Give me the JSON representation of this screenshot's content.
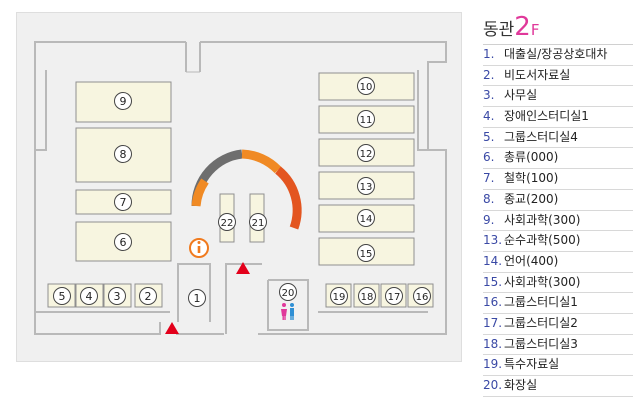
{
  "legend": {
    "building": "동관",
    "floor": "2",
    "floor_suffix": "F",
    "items": [
      {
        "num": "1.",
        "label": "대출실/장공상호대차"
      },
      {
        "num": "2.",
        "label": "비도서자료실"
      },
      {
        "num": "3.",
        "label": "사무실"
      },
      {
        "num": "4.",
        "label": "장애인스터디실1"
      },
      {
        "num": "5.",
        "label": "그룹스터디실4"
      },
      {
        "num": "6.",
        "label": "총류(000)"
      },
      {
        "num": "7.",
        "label": "철학(100)"
      },
      {
        "num": "8.",
        "label": "종교(200)"
      },
      {
        "num": "9.",
        "label": "사회과학(300)"
      },
      {
        "num": "13.",
        "label": "순수과학(500)"
      },
      {
        "num": "14.",
        "label": "언어(400)"
      },
      {
        "num": "15.",
        "label": "사회과학(300)"
      },
      {
        "num": "16.",
        "label": "그룹스터디실1"
      },
      {
        "num": "17.",
        "label": "그룹스터디실2"
      },
      {
        "num": "18.",
        "label": "그룹스터디실3"
      },
      {
        "num": "19.",
        "label": "특수자료실"
      },
      {
        "num": "20.",
        "label": "화장실"
      }
    ]
  },
  "map": {
    "rooms": [
      "9",
      "8",
      "7",
      "6",
      "10",
      "11",
      "12",
      "13",
      "14",
      "15",
      "5",
      "4",
      "3",
      "2",
      "1",
      "20",
      "19",
      "18",
      "17",
      "16",
      "22",
      "21"
    ],
    "info_icon": "info-icon",
    "entrance_icon": "entrance-triangle-icon",
    "restroom_icon": "restroom-icon"
  },
  "colors": {
    "room_fill": "#f7f5e0",
    "arc_gray": "#6e6e6e",
    "arc_orange": "#f08a24",
    "arc_red": "#e35520",
    "entrance_red": "#e3001b",
    "info_orange": "#f07a1e",
    "legend_number": "#3a49a5",
    "floor_pink": "#e0389a"
  }
}
